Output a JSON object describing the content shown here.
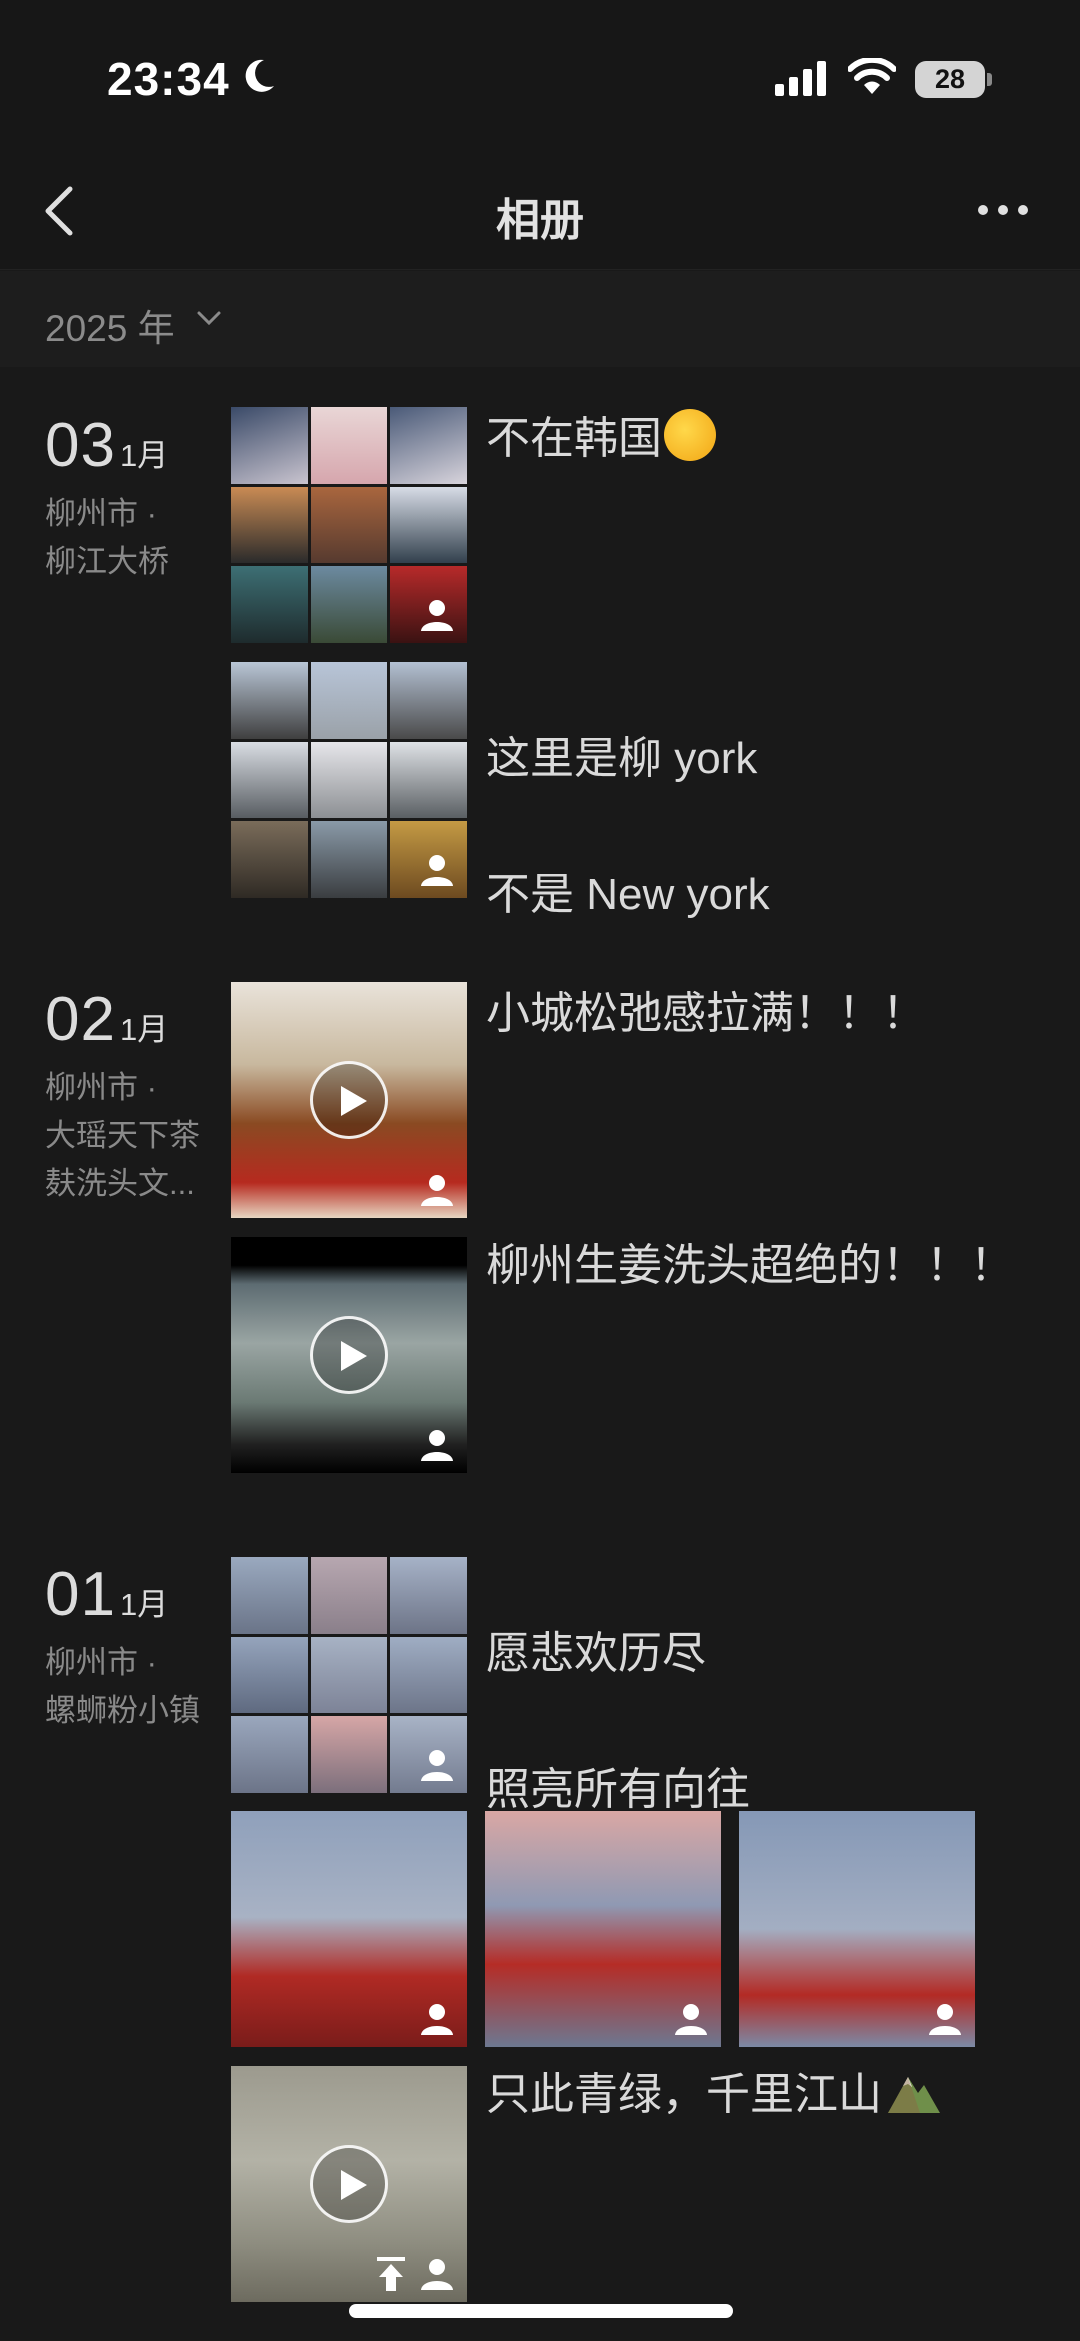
{
  "status_bar": {
    "time": "23:34",
    "battery": "28",
    "icons": [
      "moon-icon",
      "cellular-signal-icon",
      "wifi-icon",
      "battery-icon"
    ]
  },
  "nav": {
    "title": "相册",
    "back_icon": "chevron-left-icon",
    "more_icon": "more-dots-icon"
  },
  "filter": {
    "year_label": "2025 年"
  },
  "groups": [
    {
      "day": "03",
      "month": "1月",
      "location_line1": "柳州市 ·",
      "location_line2": "柳江大桥",
      "location_line3": "",
      "posts": [
        {
          "text": "不在韩国",
          "emoji": "thinking-face-emoji",
          "type": "photo-grid"
        },
        {
          "text_line1": "这里是柳 york",
          "text_line2": "不是 New york",
          "type": "photo-grid"
        }
      ]
    },
    {
      "day": "02",
      "month": "1月",
      "location_line1": "柳州市 ·",
      "location_line2": "大瑶天下茶",
      "location_line3": "麸洗头文...",
      "posts": [
        {
          "text": "小城松弛感拉满！！！",
          "type": "video"
        },
        {
          "text": "柳州生姜洗头超绝的！！！",
          "type": "video"
        }
      ]
    },
    {
      "day": "01",
      "month": "1月",
      "location_line1": "柳州市 ·",
      "location_line2": "螺蛳粉小镇",
      "location_line3": "",
      "posts": [
        {
          "text_line1": "愿悲欢历尽",
          "text_line2": "照亮所有向往",
          "text_line3": "...",
          "type": "photo-grid"
        },
        {
          "type": "photo-row",
          "count": 3
        },
        {
          "text": "只此青绿，千里江山",
          "emoji": "mountain-emoji",
          "type": "video"
        }
      ]
    }
  ],
  "colors": {
    "background": "#191919",
    "text_primary": "#dadada",
    "text_secondary": "#8a8a8a"
  }
}
